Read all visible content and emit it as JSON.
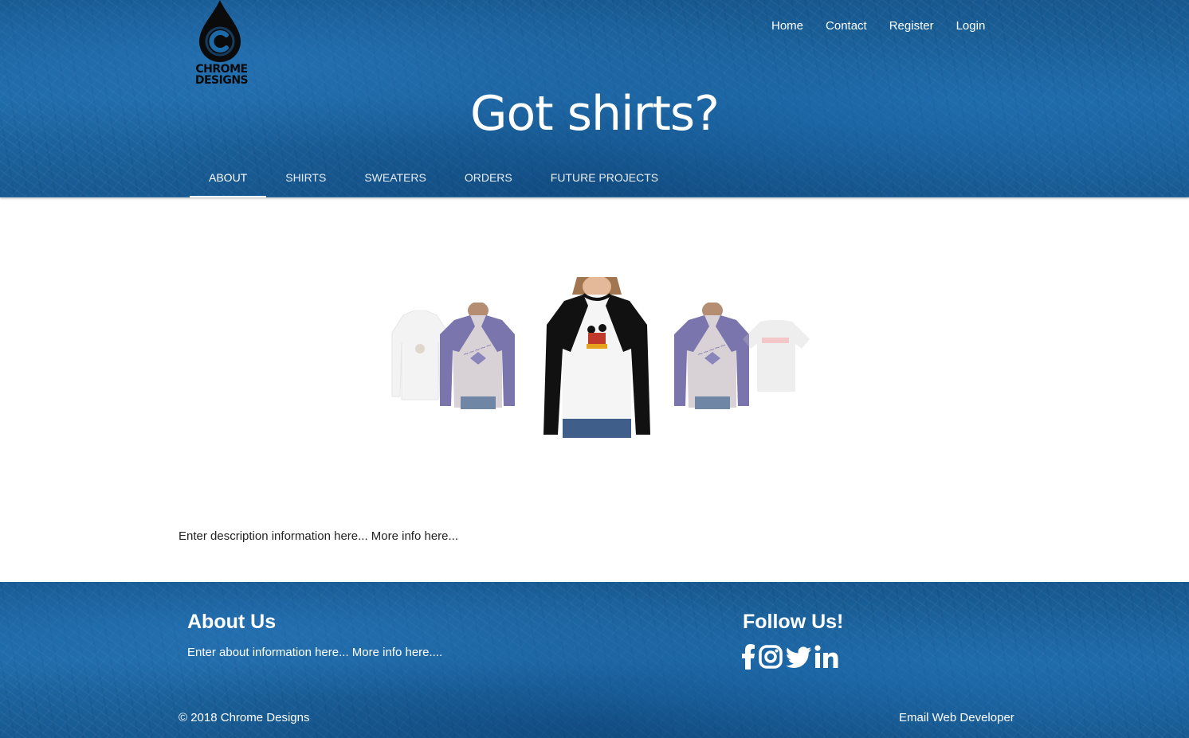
{
  "brand": {
    "logo_letter": "C",
    "logo_text_line1": "CHROME",
    "logo_text_line2": "DESIGNS"
  },
  "topnav": {
    "items": [
      {
        "label": "Home"
      },
      {
        "label": "Contact"
      },
      {
        "label": "Register"
      },
      {
        "label": "Login"
      }
    ]
  },
  "hero": {
    "title": "Got shirts?"
  },
  "tabs": {
    "active": "ABOUT",
    "items": [
      {
        "label": "ABOUT"
      },
      {
        "label": "SHIRTS"
      },
      {
        "label": "SWEATERS"
      },
      {
        "label": "ORDERS"
      },
      {
        "label": "FUTURE PROJECTS"
      }
    ]
  },
  "carousel": {
    "slides": [
      {
        "name": "white-long-sleeve-tee",
        "state": "faded"
      },
      {
        "name": "purple-raglan-tee-man",
        "state": "side"
      },
      {
        "name": "black-raglan-mickey-tee",
        "state": "active"
      },
      {
        "name": "purple-raglan-tee-man",
        "state": "side"
      },
      {
        "name": "white-tshirt-red-print",
        "state": "faded"
      }
    ]
  },
  "main": {
    "description": "Enter description information here... More info here..."
  },
  "footer": {
    "about_title": "About Us",
    "about_text": "Enter about information here... More info here....",
    "follow_title": "Follow Us!",
    "social_icons": [
      "facebook-icon",
      "instagram-icon",
      "twitter-icon",
      "linkedin-icon"
    ],
    "copyright": "© 2018 Chrome Designs",
    "email_link": "Email Web Developer"
  },
  "colors": {
    "header_blue": "#1d5e96",
    "text_white": "#ffffff",
    "body_text": "#222222",
    "purple_sleeve": "#7a75ad",
    "tshirt_red": "#d94a4a"
  }
}
